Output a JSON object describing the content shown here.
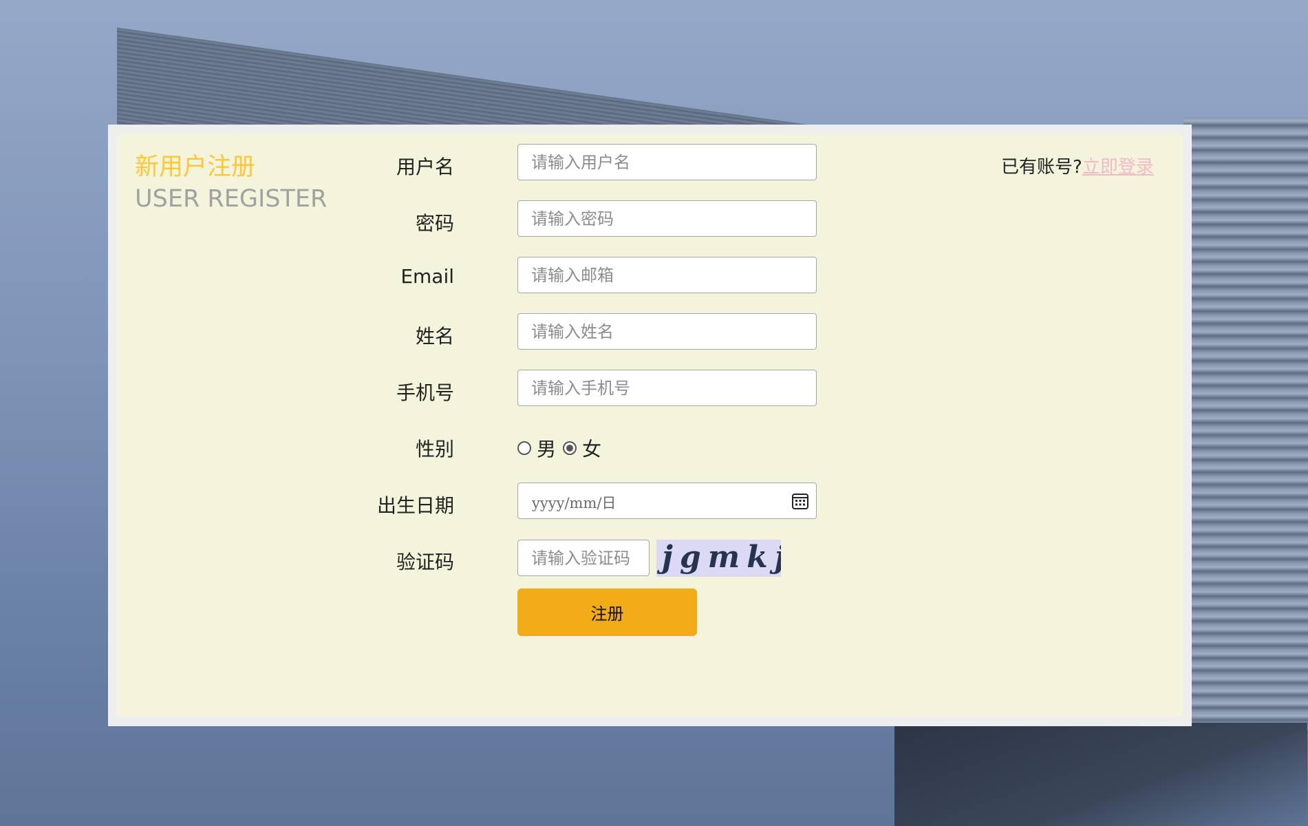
{
  "header": {
    "title_cn": "新用户注册",
    "title_en": "USER REGISTER"
  },
  "login": {
    "prompt": "已有账号?",
    "link": "立即登录",
    "link_color": "#f5b8c9"
  },
  "form": {
    "username": {
      "label": "用户名",
      "placeholder": "请输入用户名",
      "value": ""
    },
    "password": {
      "label": "密码",
      "placeholder": "请输入密码",
      "value": ""
    },
    "email": {
      "label": "Email",
      "placeholder": "请输入邮箱",
      "value": ""
    },
    "name": {
      "label": "姓名",
      "placeholder": "请输入姓名",
      "value": ""
    },
    "phone": {
      "label": "手机号",
      "placeholder": "请输入手机号",
      "value": ""
    },
    "gender": {
      "label": "性别",
      "options": [
        "男",
        "女"
      ],
      "selected": "女"
    },
    "birthday": {
      "label": "出生日期",
      "placeholder": "yyyy/mm/日",
      "icon": "calendar-icon"
    },
    "captcha": {
      "label": "验证码",
      "placeholder": "请输入验证码",
      "image_text": "jgmkj"
    },
    "submit_label": "注册"
  },
  "colors": {
    "accent": "#f0ab17",
    "title_cn": "#ffc738",
    "title_en": "#a1a1a1",
    "card_bg": "#f4f3dc"
  }
}
